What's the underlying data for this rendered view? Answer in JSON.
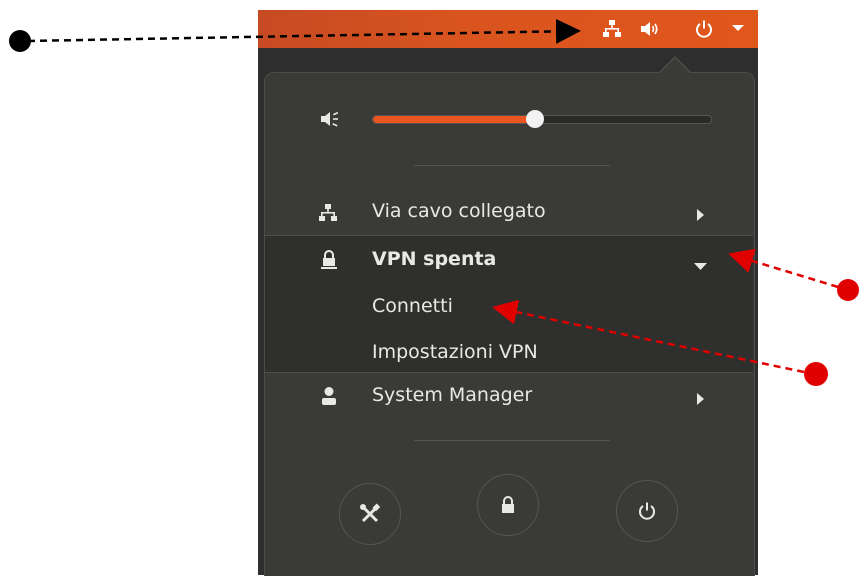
{
  "topbar": {
    "icons": [
      "network-wired-icon",
      "volume-icon",
      "power-icon",
      "menu-arrow-icon"
    ]
  },
  "menu": {
    "volume": {
      "icon": "volume-icon",
      "level_percent": 48
    },
    "wired": {
      "label": "Via cavo collegato",
      "icon": "network-wired-icon"
    },
    "vpn": {
      "label": "VPN spenta",
      "icon": "vpn-lock-icon",
      "items": [
        "Connetti",
        "Impostazioni VPN"
      ]
    },
    "user": {
      "label": "System Manager",
      "icon": "user-icon"
    },
    "actions": [
      "settings-icon",
      "lock-icon",
      "power-icon"
    ]
  },
  "colors": {
    "accent": "#e0571c",
    "menu_bg": "#3a3a37",
    "text": "#e8e8e6",
    "annotation_black": "#000000",
    "annotation_red": "#e10000"
  }
}
